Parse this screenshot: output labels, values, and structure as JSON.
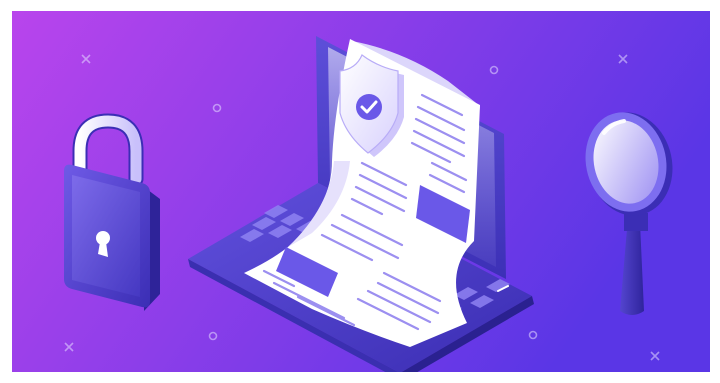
{
  "illustration": {
    "subject": "laptop-document-security",
    "elements": [
      "padlock-icon",
      "laptop",
      "document-sheet",
      "shield-check-icon",
      "magnifying-glass-icon"
    ]
  },
  "colors": {
    "background_left": "#b945ec",
    "background_right": "#5a36e6",
    "laptop_dark": "#3a2fb8",
    "laptop_mid": "#5a4ad6",
    "accent_light": "#ece8ff",
    "paper": "#ffffff",
    "paper_line": "#9c8ff0",
    "paper_block": "#6a58e8"
  }
}
